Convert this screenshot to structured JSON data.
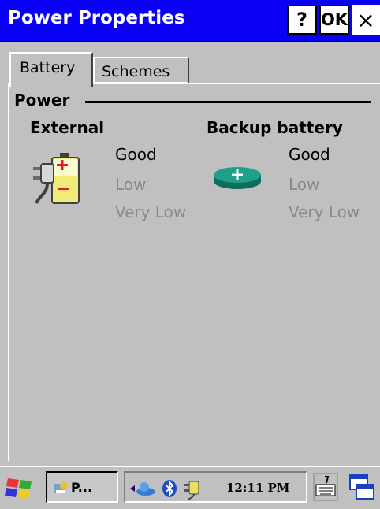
{
  "window": {
    "title": "Power Properties",
    "help_label": "?",
    "ok_label": "OK",
    "close_label": "×"
  },
  "tabs": [
    {
      "label": "Battery",
      "selected": true
    },
    {
      "label": "Schemes",
      "selected": false
    }
  ],
  "power": {
    "section_label": "Power",
    "external": {
      "heading": "External",
      "icon": "plug-battery-icon",
      "levels": [
        "Good",
        "Low",
        "Very Low"
      ],
      "active_level": "Good"
    },
    "backup": {
      "heading": "Backup battery",
      "icon": "coin-battery-icon",
      "levels": [
        "Good",
        "Low",
        "Very Low"
      ],
      "active_level": "Good"
    }
  },
  "taskbar": {
    "task_label": "P...",
    "clock": "12:11 PM",
    "tray_icons": [
      "network-icon",
      "bluetooth-icon",
      "power-plug-icon"
    ]
  },
  "colors": {
    "titlebar": "#0a00f8",
    "dialog": "#c0c0c0",
    "inactive_text": "#8a8a8a",
    "coin_battery": "#1fa08a"
  }
}
